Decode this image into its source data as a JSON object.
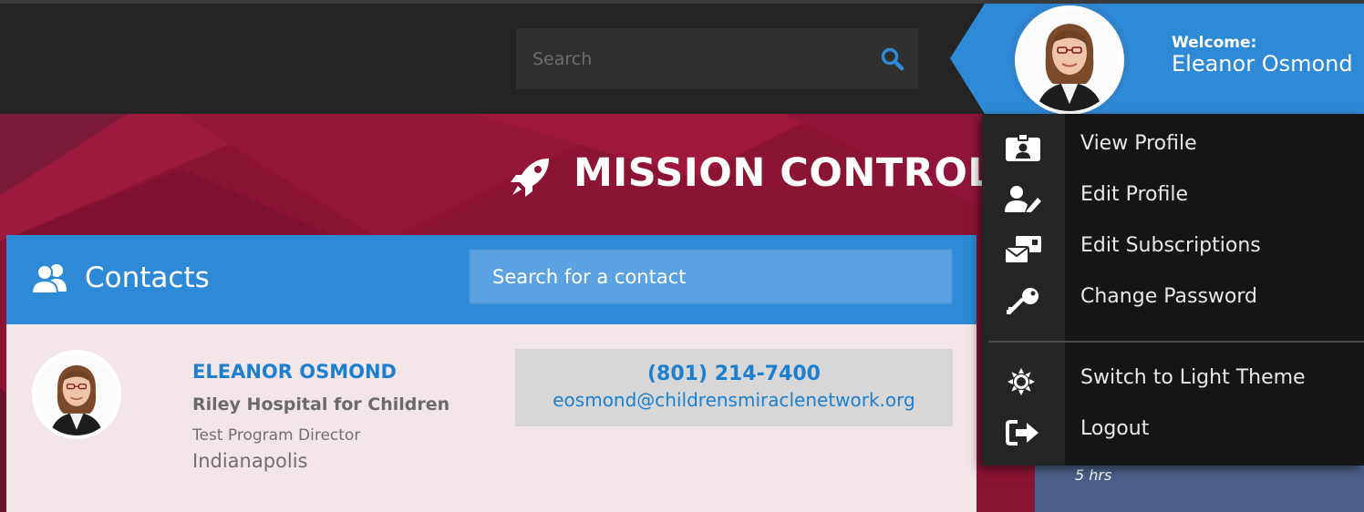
{
  "topbar": {
    "search_placeholder": "Search",
    "welcome_label": "Welcome:",
    "user_name": "Eleanor Osmond"
  },
  "hero": {
    "title": "MISSION CONTROL"
  },
  "contacts": {
    "title": "Contacts",
    "search_placeholder": "Search for a contact",
    "items": [
      {
        "name": "ELEANOR OSMOND",
        "organization": "Riley Hospital for Children",
        "role": "Test Program Director",
        "city": "Indianapolis",
        "phone": "(801) 214-7400",
        "email": "eosmond@childrensmiraclenetwork.org"
      }
    ]
  },
  "side_panel": {
    "text": "5 hrs"
  },
  "user_menu": {
    "items": [
      {
        "label": "View Profile",
        "icon": "id-badge-icon"
      },
      {
        "label": "Edit Profile",
        "icon": "user-edit-icon"
      },
      {
        "label": "Edit Subscriptions",
        "icon": "mail-bulk-icon"
      },
      {
        "label": "Change Password",
        "icon": "key-icon"
      },
      {
        "label": "Switch to Light Theme",
        "icon": "sun-icon"
      },
      {
        "label": "Logout",
        "icon": "logout-icon"
      }
    ]
  },
  "colors": {
    "accent_blue": "#2e8ad7",
    "hero_crimson": "#8b1434",
    "topbar_bg": "#242424",
    "menu_bg": "#151515"
  }
}
